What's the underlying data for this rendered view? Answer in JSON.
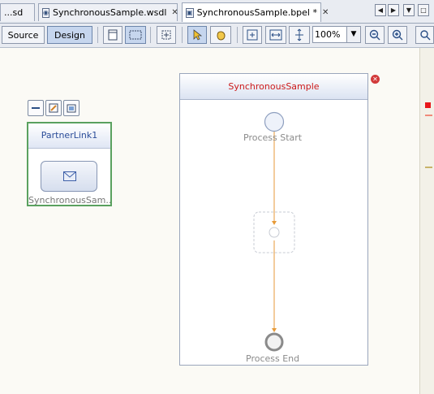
{
  "tabs": [
    {
      "label": "...sd",
      "active": false,
      "closable": false
    },
    {
      "label": "SynchronousSample.wsdl",
      "active": false,
      "closable": true
    },
    {
      "label": "SynchronousSample.bpel *",
      "active": true,
      "closable": true
    }
  ],
  "toolbar": {
    "source_label": "Source",
    "design_label": "Design",
    "zoom_value": "100%"
  },
  "partner_link": {
    "name": "PartnerLink1",
    "role_label": "SynchronousSam..."
  },
  "process": {
    "name": "SynchronousSample",
    "start_label": "Process Start",
    "end_label": "Process End"
  },
  "colors": {
    "process_title": "#cc1a1a",
    "partner_border": "#5aa15f",
    "flow_line": "#e79a38",
    "error_badge": "#d23a3a"
  },
  "icons": {
    "wsdl_tab": "wsdl-file-icon",
    "bpel_tab": "bpel-file-icon",
    "error_badge": "error-icon"
  }
}
